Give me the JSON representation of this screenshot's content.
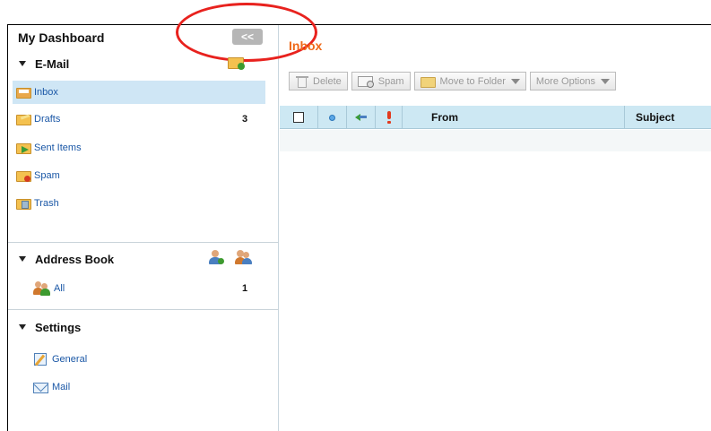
{
  "sidebar": {
    "title": "My Dashboard",
    "collapse_label": "<<",
    "email_section": "E-Mail",
    "folders": [
      {
        "label": "Inbox",
        "count": ""
      },
      {
        "label": "Drafts",
        "count": "3"
      },
      {
        "label": "Sent Items",
        "count": ""
      },
      {
        "label": "Spam",
        "count": ""
      },
      {
        "label": "Trash",
        "count": ""
      }
    ],
    "address_book_section": "Address Book",
    "address_items": [
      {
        "label": "All",
        "count": "1"
      }
    ],
    "settings_section": "Settings",
    "settings_items": [
      {
        "label": "General"
      },
      {
        "label": "Mail"
      }
    ]
  },
  "main": {
    "title": "Inbox",
    "toolbar": {
      "delete_label": "Delete",
      "spam_label": "Spam",
      "move_label": "Move to Folder",
      "more_label": "More Options"
    },
    "table_headers": {
      "from": "From",
      "subject": "Subject"
    }
  },
  "colors": {
    "accent": "#ef6a1a",
    "link": "#1a57a6",
    "header_bg": "#cde8f3",
    "selected_bg": "#cfe6f5",
    "annotation": "#e8221e"
  },
  "icons": [
    "collapse-icon",
    "new-folder-icon",
    "inbox-icon",
    "drafts-icon",
    "sent-icon",
    "spam-folder-icon",
    "trash-icon",
    "add-contact-icon",
    "add-group-icon",
    "contacts-icon",
    "general-settings-icon",
    "mail-settings-icon",
    "delete-icon",
    "spam-icon",
    "move-folder-icon",
    "priority-icon",
    "reply-icon",
    "status-icon"
  ]
}
